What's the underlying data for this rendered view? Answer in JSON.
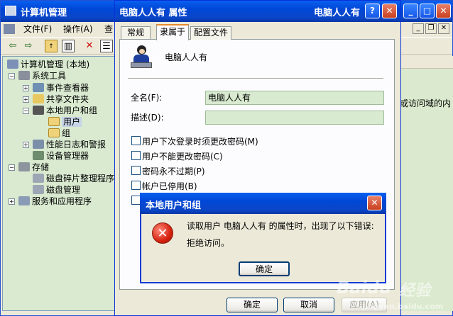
{
  "main_window": {
    "title": "计算机管理",
    "menu": [
      "文件(F)",
      "操作(A)",
      "查"
    ],
    "tree": [
      {
        "label": "计算机管理 (本地)"
      },
      {
        "label": "系统工具"
      },
      {
        "label": "事件查看器"
      },
      {
        "label": "共享文件夹"
      },
      {
        "label": "本地用户和组"
      },
      {
        "label": "用户"
      },
      {
        "label": "组"
      },
      {
        "label": "性能日志和警报"
      },
      {
        "label": "设备管理器"
      },
      {
        "label": "存储"
      },
      {
        "label": "磁盘碎片整理程序"
      },
      {
        "label": "磁盘管理"
      },
      {
        "label": "服务和应用程序"
      }
    ],
    "right_text": "或访问域的内"
  },
  "properties_dialog": {
    "title": "电脑人人有 属性",
    "title_right": "电脑人人有",
    "tabs": [
      "常规",
      "隶属于",
      "配置文件"
    ],
    "username": "电脑人人有",
    "fullname_label": "全名(F):",
    "fullname_value": "电脑人人有",
    "description_label": "描述(D):",
    "description_value": "",
    "checkboxes": [
      {
        "label": "用户下次登录时须更改密码(M)",
        "checked": false
      },
      {
        "label": "用户不能更改密码(C)",
        "checked": false
      },
      {
        "label": "密码永不过期(P)",
        "checked": false
      },
      {
        "label": "帐户已停用(B)",
        "checked": false
      }
    ],
    "ok_button": "确定",
    "cancel_button": "取消",
    "apply_button": "应用(A)"
  },
  "error_dialog": {
    "title": "本地用户和组",
    "message_line1": "读取用户 电脑人人有 的属性时，出现了以下错误:",
    "message_line2": "拒绝访问。",
    "ok_button": "确定"
  },
  "watermark": {
    "brand": "Baidu",
    "suffix": "经验",
    "url": "jingyan.baidu.com"
  }
}
